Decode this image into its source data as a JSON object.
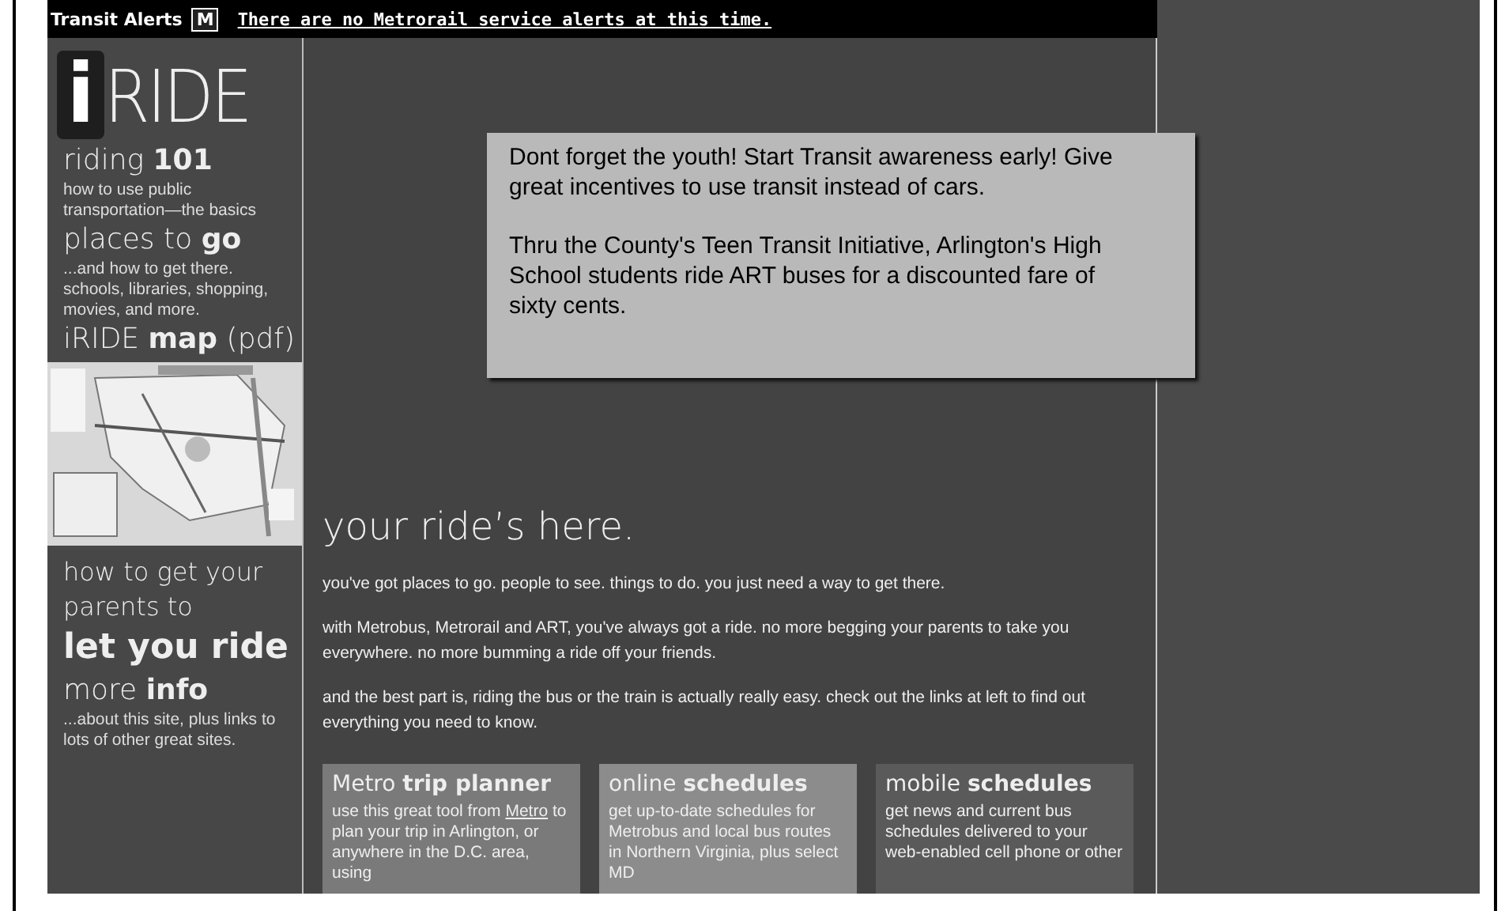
{
  "alert_bar": {
    "label": "Transit Alerts",
    "badge": "M",
    "message": "There are no Metrorail service alerts at this time."
  },
  "logo": {
    "mark": "i",
    "word": "RIDE"
  },
  "sidebar": {
    "items": [
      {
        "kind": "link",
        "title": "riding **101**",
        "description": "how to use public transportation—the basics"
      },
      {
        "kind": "link",
        "title": "places to **go**",
        "description": "...and how to get there. schools, libraries, shopping, movies, and more."
      },
      {
        "kind": "link",
        "title": "iRIDE **map** (pdf)"
      },
      {
        "kind": "picture"
      },
      {
        "kind": "big",
        "title": "how to get your parents to",
        "emphasis": "let you ride"
      },
      {
        "kind": "link",
        "title": "more **info**",
        "description": "...about this site, plus links to lots of other great sites."
      }
    ]
  },
  "note": {
    "paragraphs": [
      "Dont forget the youth! Start Transit awareness early! Give great incentives to use transit instead of cars.",
      "Thru the County's Teen Transit Initiative, Arlington's High School students ride ART buses for a discounted fare of sixty cents."
    ]
  },
  "main": {
    "heading": "your ride’s here.",
    "paragraphs": [
      "you've got places to go. people to see. things to do. you just need a way to get there.",
      "with Metrobus, Metrorail and ART, you've always got a ride. no more begging your parents to take you everywhere. no more bumming a ride off your friends.",
      "and the best part is, riding the bus or the train is actually really easy. check out the links at left to find out everything you need to know."
    ]
  },
  "cards": [
    {
      "title": "Metro **trip planner**",
      "text_before": "use this great tool from ",
      "link": "Metro",
      "text_after": " to plan your trip in Arlington, or anywhere in the D.C. area, using",
      "color": "#7a7a7a"
    },
    {
      "title": "online **schedules**",
      "text_before": "get up-to-date schedules for Metrobus and local bus routes in Northern Virginia, plus select MD",
      "color": "#8c8c8c"
    },
    {
      "title": "mobile **schedules**",
      "text_before": "get news and current bus schedules delivered to your web-enabled cell phone or other",
      "color": "#5a5a5a"
    }
  ]
}
